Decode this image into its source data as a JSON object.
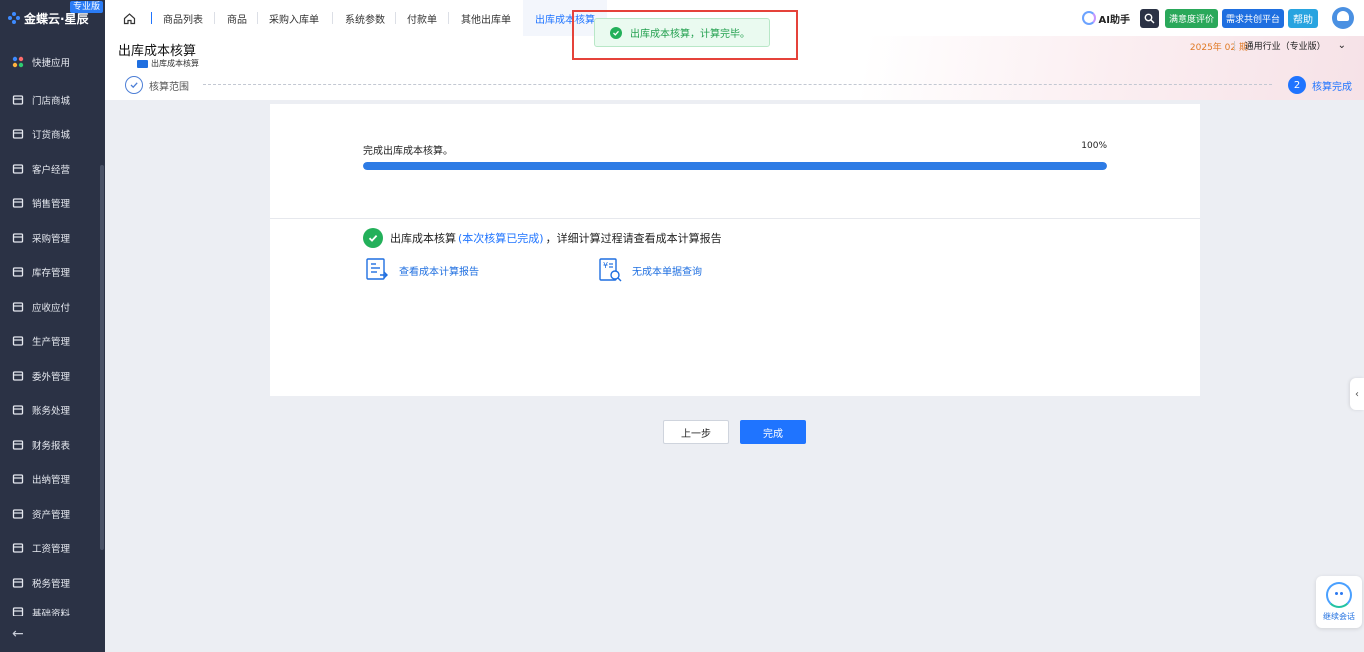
{
  "app": {
    "brand": "金蝶云·星辰",
    "edition_badge": "专业版"
  },
  "sidebar": {
    "items": [
      {
        "label": "快捷应用",
        "icon": "grid-apps-icon"
      },
      {
        "label": "门店商城",
        "icon": "store-icon"
      },
      {
        "label": "订货商城",
        "icon": "bag-icon"
      },
      {
        "label": "客户经营",
        "icon": "user-icon"
      },
      {
        "label": "销售管理",
        "icon": "chart-icon"
      },
      {
        "label": "采购管理",
        "icon": "cart-icon"
      },
      {
        "label": "库存管理",
        "icon": "box-icon"
      },
      {
        "label": "应收应付",
        "icon": "coin-icon"
      },
      {
        "label": "生产管理",
        "icon": "factory-icon"
      },
      {
        "label": "委外管理",
        "icon": "outsource-icon"
      },
      {
        "label": "账务处理",
        "icon": "ledger-icon"
      },
      {
        "label": "财务报表",
        "icon": "report-icon"
      },
      {
        "label": "出纳管理",
        "icon": "cashier-icon"
      },
      {
        "label": "资产管理",
        "icon": "asset-icon"
      },
      {
        "label": "工资管理",
        "icon": "salary-icon"
      },
      {
        "label": "税务管理",
        "icon": "tax-icon"
      },
      {
        "label": "基础资料",
        "icon": "base-data-icon"
      }
    ],
    "back_icon": "arrow-left-icon"
  },
  "tabs": [
    {
      "label": "商品列表"
    },
    {
      "label": "商品"
    },
    {
      "label": "采购入库单"
    },
    {
      "label": "系统参数"
    },
    {
      "label": "付款单"
    },
    {
      "label": "其他出库单"
    },
    {
      "label": "出库成本核算"
    }
  ],
  "topbar": {
    "ai_label": "AI助手",
    "satisfaction_label": "满意度评价",
    "demand_label": "需求共创平台",
    "help_label": "帮助"
  },
  "header": {
    "title": "出库成本核算",
    "video_link": "出库成本核算",
    "period": "2025年 02 期",
    "industry": "通用行业（专业版）"
  },
  "steps": {
    "step1_label": "核算范围",
    "step2_number": "2",
    "step2_label": "核算完成"
  },
  "progress": {
    "label": "完成出库成本核算。",
    "percent_text": "100%",
    "value": 1.0
  },
  "result": {
    "prefix": "出库成本核算",
    "highlight": "(本次核算已完成)",
    "suffix": "，详细计算过程请查看成本计算报告",
    "link_report": "查看成本计算报告",
    "link_nocost": "无成本单据查询"
  },
  "buttons": {
    "prev": "上一步",
    "done": "完成"
  },
  "toast": {
    "message": "出库成本核算，计算完毕。"
  },
  "chat_widget": {
    "label": "继续会话"
  },
  "colors": {
    "primary": "#1f74ff",
    "sidebar_bg": "#2b3245",
    "success": "#23b05a",
    "period_orange": "#e07a26",
    "highlight_frame": "#e5423a"
  }
}
